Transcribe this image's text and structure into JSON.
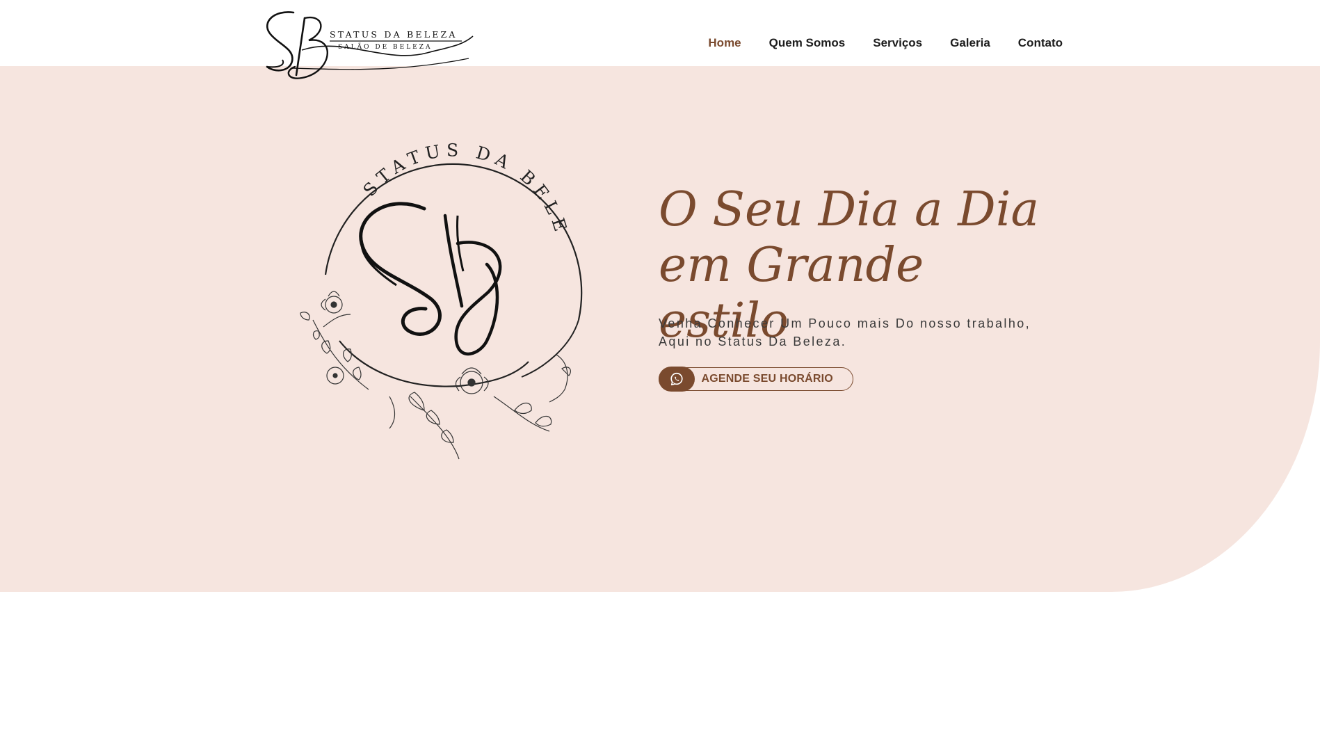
{
  "brand": {
    "logo_line1": "STATUS DA BELEZA",
    "logo_line2": "SALÃO DE BELEZA",
    "monogram": "SB",
    "emblem_text": "STATUS DA BELEZA"
  },
  "nav": {
    "items": [
      {
        "label": "Home",
        "active": true
      },
      {
        "label": "Quem Somos",
        "active": false
      },
      {
        "label": "Serviços",
        "active": false
      },
      {
        "label": "Galeria",
        "active": false
      },
      {
        "label": "Contato",
        "active": false
      }
    ]
  },
  "hero": {
    "title_line1": "O Seu Dia a Dia",
    "title_line2": "em Grande estilo",
    "subtitle_line1": "Venha Conhecer Um Pouco mais Do nosso trabalho,",
    "subtitle_line2": "Aqui no Status Da Beleza.",
    "cta_label": "AGENDE SEU HORÁRIO",
    "cta_icon": "whatsapp-icon"
  },
  "colors": {
    "accent": "#7a4a2e",
    "hero_bg": "#f6e5df",
    "text": "#1d1d1d"
  }
}
